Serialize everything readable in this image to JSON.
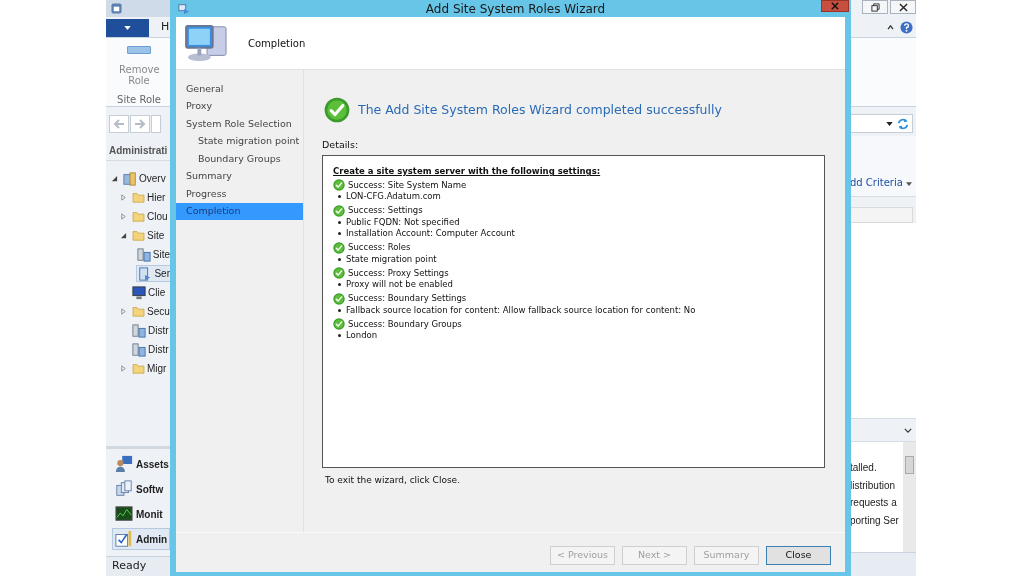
{
  "console": {
    "ribbon_tab": "H",
    "ribbon_button": "Remove Role",
    "ribbon_group": "Site Role",
    "workspace": "Administrati",
    "tree": [
      {
        "label": "Overv",
        "kind": "overview",
        "expanded": true,
        "selected": false,
        "children": [
          {
            "label": "Hier",
            "kind": "folder",
            "expanded": false,
            "selected": false
          },
          {
            "label": "Clou",
            "kind": "folder",
            "expanded": false,
            "selected": false
          },
          {
            "label": "Site",
            "kind": "folder",
            "expanded": true,
            "selected": false,
            "children": [
              {
                "label": "Site",
                "kind": "servers",
                "selected": false
              },
              {
                "label": "Ser",
                "kind": "server",
                "selected": true
              }
            ]
          },
          {
            "label": "Clie",
            "kind": "monitor",
            "selected": false
          },
          {
            "label": "Secu",
            "kind": "folder",
            "expanded": false,
            "selected": false
          },
          {
            "label": "Distr",
            "kind": "servers",
            "selected": false
          },
          {
            "label": "Distr",
            "kind": "servers",
            "selected": false
          },
          {
            "label": "Migr",
            "kind": "folder",
            "expanded": false,
            "selected": false
          }
        ]
      }
    ],
    "workspaces": [
      {
        "label": "Assets",
        "kind": "person",
        "selected": false
      },
      {
        "label": "Softw",
        "kind": "boxes",
        "selected": false
      },
      {
        "label": "Monit",
        "kind": "chart",
        "selected": false
      },
      {
        "label": "Admin",
        "kind": "checklist",
        "selected": true
      }
    ],
    "status": "Ready",
    "criteria": "dd Criteria",
    "messages": [
      "talled.",
      "listribution",
      "requests a",
      "porting Ser"
    ]
  },
  "wizard": {
    "title": "Add Site System Roles Wizard",
    "page_title": "Completion",
    "steps": [
      {
        "label": "General",
        "selected": false
      },
      {
        "label": "Proxy",
        "selected": false
      },
      {
        "label": "System Role Selection",
        "selected": false,
        "children": [
          {
            "label": "State migration point",
            "selected": false
          },
          {
            "label": "Boundary Groups",
            "selected": false
          }
        ]
      },
      {
        "label": "Summary",
        "selected": false
      },
      {
        "label": "Progress",
        "selected": false
      },
      {
        "label": "Completion",
        "selected": true
      }
    ],
    "result": "The Add Site System Roles Wizard completed successfully",
    "details_label": "Details:",
    "details_heading": "Create a site system server with the following settings:",
    "details": [
      {
        "title": "Success: Site System Name",
        "items": [
          "LON-CFG.Adatum.com"
        ]
      },
      {
        "title": "Success: Settings",
        "items": [
          "Public FQDN: Not specified",
          "Installation Account: Computer Account"
        ]
      },
      {
        "title": "Success: Roles",
        "items": [
          "State migration point"
        ]
      },
      {
        "title": "Success: Proxy Settings",
        "items": [
          "Proxy will not be enabled"
        ]
      },
      {
        "title": "Success: Boundary Settings",
        "items": [
          "Fallback source location for content: Allow fallback source location for content: No"
        ]
      },
      {
        "title": "Success: Boundary Groups",
        "items": [
          "London"
        ]
      }
    ],
    "footer": "To exit the wizard, click Close.",
    "buttons": [
      {
        "label": "< Previous",
        "disabled": true
      },
      {
        "label": "Next >",
        "disabled": true
      },
      {
        "label": "Summary",
        "disabled": true
      },
      {
        "label": "Close",
        "disabled": false
      }
    ]
  }
}
